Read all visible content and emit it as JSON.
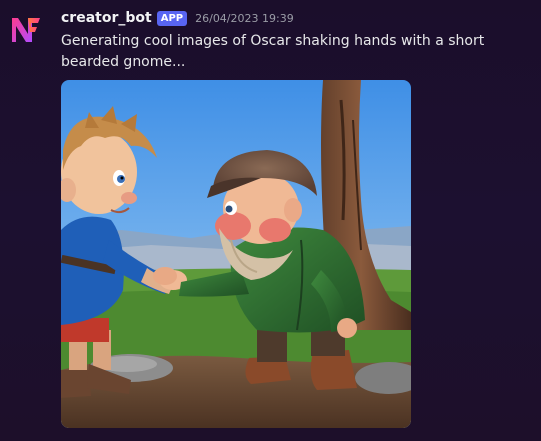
{
  "message": {
    "author": "creator_bot",
    "badge": "APP",
    "timestamp": "26/04/2023 19:39",
    "text": "Generating cool images of Oscar shaking hands with a short bearded gnome..."
  },
  "avatar": {
    "icon": "bot-logo-icon",
    "colors": [
      "#ff3c8e",
      "#ff7a3d",
      "#b14cff"
    ]
  },
  "attachment": {
    "icon": "generated-image"
  }
}
